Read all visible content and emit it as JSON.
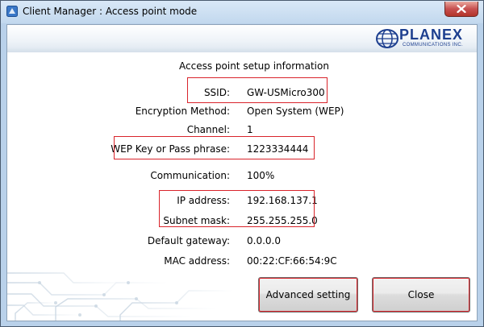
{
  "window": {
    "title": "Client Manager : Access point mode"
  },
  "brand": {
    "logo_text": "PLANEX",
    "logo_sub": "COMMUNICATIONS INC.",
    "color": "#1d3f8f"
  },
  "section_title": "Access point setup information",
  "fields": [
    {
      "label": "SSID:",
      "value": "GW-USMicro300"
    },
    {
      "label": "Encryption Method:",
      "value": "Open System (WEP)"
    },
    {
      "label": "Channel:",
      "value": "1"
    },
    {
      "label": "WEP Key or Pass phrase:",
      "value": "1223334444"
    },
    {
      "label": "Communication:",
      "value": "100%"
    },
    {
      "label": "IP address:",
      "value": "192.168.137.1"
    },
    {
      "label": "Subnet mask:",
      "value": "255.255.255.0"
    },
    {
      "label": "Default gateway:",
      "value": "0.0.0.0"
    },
    {
      "label": "MAC address:",
      "value": "00:22:CF:66:54:9C"
    }
  ],
  "buttons": {
    "advanced": "Advanced setting",
    "close": "Close"
  },
  "colors": {
    "highlight": "#d9242b",
    "frame": "#b9d1ea"
  }
}
